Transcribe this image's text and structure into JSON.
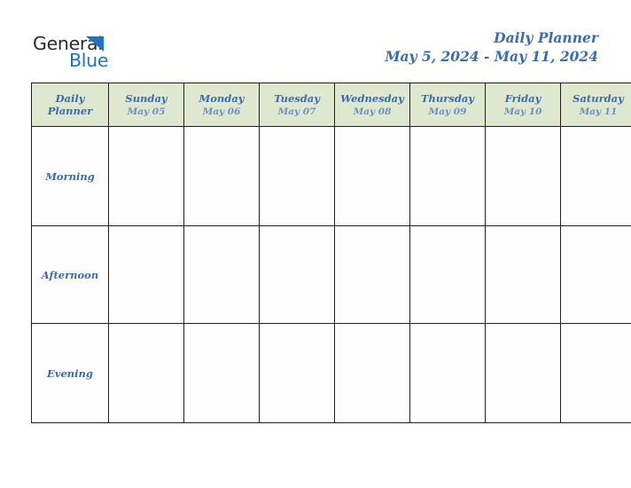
{
  "brand": {
    "logo_text_1": "General",
    "logo_text_2": "Blue",
    "logo_icon": "blue-triangle-icon",
    "colors": {
      "logo_dark": "#2b2b2b",
      "logo_blue": "#1f72bd",
      "accent_blue": "#3a6cb0",
      "header_green": "#dee8cf",
      "row_label_gray": "#e9e9e9",
      "border": "#231f20"
    }
  },
  "header": {
    "title": "Daily Planner",
    "date_range": "May 5, 2024 - May 11, 2024"
  },
  "table": {
    "corner_label_line1": "Daily",
    "corner_label_line2": "Planner",
    "columns": [
      {
        "name": "Sunday",
        "date": "May 05"
      },
      {
        "name": "Monday",
        "date": "May 06"
      },
      {
        "name": "Tuesday",
        "date": "May 07"
      },
      {
        "name": "Wednesday",
        "date": "May 08"
      },
      {
        "name": "Thursday",
        "date": "May 09"
      },
      {
        "name": "Friday",
        "date": "May 10"
      },
      {
        "name": "Saturday",
        "date": "May 11"
      }
    ],
    "rows": [
      {
        "label": "Morning",
        "cells": [
          "",
          "",
          "",
          "",
          "",
          "",
          ""
        ]
      },
      {
        "label": "Afternoon",
        "cells": [
          "",
          "",
          "",
          "",
          "",
          "",
          ""
        ]
      },
      {
        "label": "Evening",
        "cells": [
          "",
          "",
          "",
          "",
          "",
          "",
          ""
        ]
      }
    ]
  }
}
